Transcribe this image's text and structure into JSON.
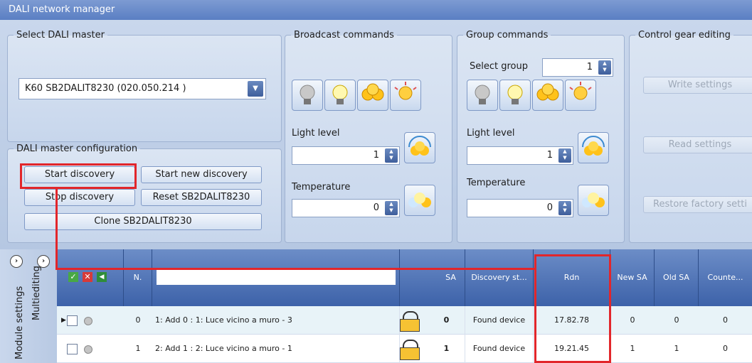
{
  "window": {
    "title": "DALI network manager"
  },
  "select_master": {
    "legend": "Select DALI master",
    "selected": "K60 SB2DALIT8230 (020.050.214 )"
  },
  "master_config": {
    "legend": "DALI master configuration",
    "start_discovery": "Start discovery",
    "start_new_discovery": "Start new discovery",
    "stop_discovery": "Stop discovery",
    "reset": "Reset SB2DALIT8230",
    "clone": "Clone SB2DALIT8230"
  },
  "broadcast": {
    "legend": "Broadcast commands",
    "light_level_label": "Light level",
    "light_level": "1",
    "temperature_label": "Temperature",
    "temperature": "0"
  },
  "group": {
    "legend": "Group commands",
    "select_group_label": "Select group",
    "select_group": "1",
    "light_level_label": "Light level",
    "light_level": "1",
    "temperature_label": "Temperature",
    "temperature": "0"
  },
  "gear_editing": {
    "legend": "Control gear editing",
    "write": "Write settings",
    "read": "Read settings",
    "restore": "Restore factory setti"
  },
  "side_tabs": {
    "module_settings": "Module settings",
    "multiediting": "Multiediting"
  },
  "grid": {
    "columns": {
      "n": "N.",
      "sa": "SA",
      "discovery": "Discovery st...",
      "rdn": "Rdn",
      "new_sa": "New SA",
      "old_sa": "Old SA",
      "counter": "Counte..."
    },
    "rows": [
      {
        "n": "0",
        "name": "1: Add 0 : 1: Luce vicino a muro - 3",
        "sa": "0",
        "discovery": "Found device",
        "rdn": "17.82.78",
        "new_sa": "0",
        "old_sa": "0",
        "counter": "0"
      },
      {
        "n": "1",
        "name": "2: Add 1 : 2: Luce vicino a muro - 1",
        "sa": "1",
        "discovery": "Found device",
        "rdn": "19.21.45",
        "new_sa": "1",
        "old_sa": "1",
        "counter": "0"
      }
    ]
  },
  "colors": {
    "accent": "#3d62a9",
    "highlight": "#e2262b"
  }
}
